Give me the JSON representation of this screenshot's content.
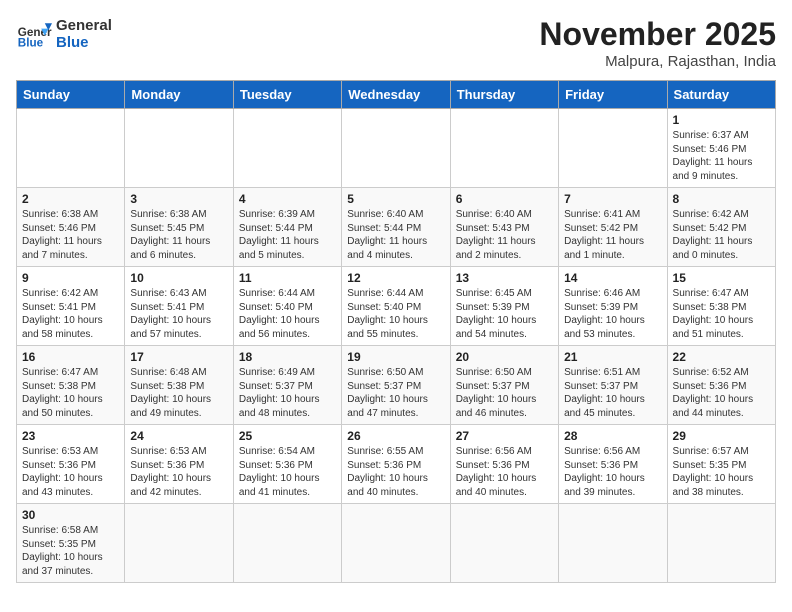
{
  "header": {
    "logo_general": "General",
    "logo_blue": "Blue",
    "month_title": "November 2025",
    "subtitle": "Malpura, Rajasthan, India"
  },
  "days_of_week": [
    "Sunday",
    "Monday",
    "Tuesday",
    "Wednesday",
    "Thursday",
    "Friday",
    "Saturday"
  ],
  "weeks": [
    [
      {
        "day": "",
        "info": ""
      },
      {
        "day": "",
        "info": ""
      },
      {
        "day": "",
        "info": ""
      },
      {
        "day": "",
        "info": ""
      },
      {
        "day": "",
        "info": ""
      },
      {
        "day": "",
        "info": ""
      },
      {
        "day": "1",
        "info": "Sunrise: 6:37 AM\nSunset: 5:46 PM\nDaylight: 11 hours and 9 minutes."
      }
    ],
    [
      {
        "day": "2",
        "info": "Sunrise: 6:38 AM\nSunset: 5:46 PM\nDaylight: 11 hours and 7 minutes."
      },
      {
        "day": "3",
        "info": "Sunrise: 6:38 AM\nSunset: 5:45 PM\nDaylight: 11 hours and 6 minutes."
      },
      {
        "day": "4",
        "info": "Sunrise: 6:39 AM\nSunset: 5:44 PM\nDaylight: 11 hours and 5 minutes."
      },
      {
        "day": "5",
        "info": "Sunrise: 6:40 AM\nSunset: 5:44 PM\nDaylight: 11 hours and 4 minutes."
      },
      {
        "day": "6",
        "info": "Sunrise: 6:40 AM\nSunset: 5:43 PM\nDaylight: 11 hours and 2 minutes."
      },
      {
        "day": "7",
        "info": "Sunrise: 6:41 AM\nSunset: 5:42 PM\nDaylight: 11 hours and 1 minute."
      },
      {
        "day": "8",
        "info": "Sunrise: 6:42 AM\nSunset: 5:42 PM\nDaylight: 11 hours and 0 minutes."
      }
    ],
    [
      {
        "day": "9",
        "info": "Sunrise: 6:42 AM\nSunset: 5:41 PM\nDaylight: 10 hours and 58 minutes."
      },
      {
        "day": "10",
        "info": "Sunrise: 6:43 AM\nSunset: 5:41 PM\nDaylight: 10 hours and 57 minutes."
      },
      {
        "day": "11",
        "info": "Sunrise: 6:44 AM\nSunset: 5:40 PM\nDaylight: 10 hours and 56 minutes."
      },
      {
        "day": "12",
        "info": "Sunrise: 6:44 AM\nSunset: 5:40 PM\nDaylight: 10 hours and 55 minutes."
      },
      {
        "day": "13",
        "info": "Sunrise: 6:45 AM\nSunset: 5:39 PM\nDaylight: 10 hours and 54 minutes."
      },
      {
        "day": "14",
        "info": "Sunrise: 6:46 AM\nSunset: 5:39 PM\nDaylight: 10 hours and 53 minutes."
      },
      {
        "day": "15",
        "info": "Sunrise: 6:47 AM\nSunset: 5:38 PM\nDaylight: 10 hours and 51 minutes."
      }
    ],
    [
      {
        "day": "16",
        "info": "Sunrise: 6:47 AM\nSunset: 5:38 PM\nDaylight: 10 hours and 50 minutes."
      },
      {
        "day": "17",
        "info": "Sunrise: 6:48 AM\nSunset: 5:38 PM\nDaylight: 10 hours and 49 minutes."
      },
      {
        "day": "18",
        "info": "Sunrise: 6:49 AM\nSunset: 5:37 PM\nDaylight: 10 hours and 48 minutes."
      },
      {
        "day": "19",
        "info": "Sunrise: 6:50 AM\nSunset: 5:37 PM\nDaylight: 10 hours and 47 minutes."
      },
      {
        "day": "20",
        "info": "Sunrise: 6:50 AM\nSunset: 5:37 PM\nDaylight: 10 hours and 46 minutes."
      },
      {
        "day": "21",
        "info": "Sunrise: 6:51 AM\nSunset: 5:37 PM\nDaylight: 10 hours and 45 minutes."
      },
      {
        "day": "22",
        "info": "Sunrise: 6:52 AM\nSunset: 5:36 PM\nDaylight: 10 hours and 44 minutes."
      }
    ],
    [
      {
        "day": "23",
        "info": "Sunrise: 6:53 AM\nSunset: 5:36 PM\nDaylight: 10 hours and 43 minutes."
      },
      {
        "day": "24",
        "info": "Sunrise: 6:53 AM\nSunset: 5:36 PM\nDaylight: 10 hours and 42 minutes."
      },
      {
        "day": "25",
        "info": "Sunrise: 6:54 AM\nSunset: 5:36 PM\nDaylight: 10 hours and 41 minutes."
      },
      {
        "day": "26",
        "info": "Sunrise: 6:55 AM\nSunset: 5:36 PM\nDaylight: 10 hours and 40 minutes."
      },
      {
        "day": "27",
        "info": "Sunrise: 6:56 AM\nSunset: 5:36 PM\nDaylight: 10 hours and 40 minutes."
      },
      {
        "day": "28",
        "info": "Sunrise: 6:56 AM\nSunset: 5:36 PM\nDaylight: 10 hours and 39 minutes."
      },
      {
        "day": "29",
        "info": "Sunrise: 6:57 AM\nSunset: 5:35 PM\nDaylight: 10 hours and 38 minutes."
      }
    ],
    [
      {
        "day": "30",
        "info": "Sunrise: 6:58 AM\nSunset: 5:35 PM\nDaylight: 10 hours and 37 minutes."
      },
      {
        "day": "",
        "info": ""
      },
      {
        "day": "",
        "info": ""
      },
      {
        "day": "",
        "info": ""
      },
      {
        "day": "",
        "info": ""
      },
      {
        "day": "",
        "info": ""
      },
      {
        "day": "",
        "info": ""
      }
    ]
  ]
}
